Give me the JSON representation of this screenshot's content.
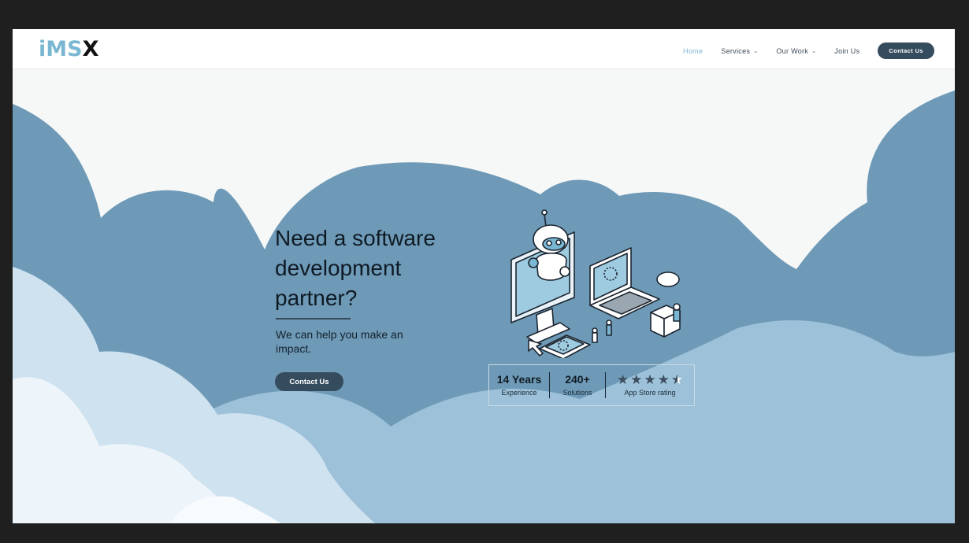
{
  "brand": {
    "logo_part1": "iMS",
    "logo_part2": "X"
  },
  "nav": {
    "items": [
      {
        "label": "Home",
        "active": true,
        "dropdown": false
      },
      {
        "label": "Services",
        "active": false,
        "dropdown": true
      },
      {
        "label": "Our Work",
        "active": false,
        "dropdown": true
      },
      {
        "label": "Join Us",
        "active": false,
        "dropdown": false
      }
    ],
    "cta_label": "Contact Us"
  },
  "hero": {
    "headline": "Need a software development partner?",
    "subtext": "We can help you make an impact.",
    "cta_label": "Contact Us"
  },
  "stats": [
    {
      "value": "14 Years",
      "label": "Experience"
    },
    {
      "value": "240+",
      "label": "Solutions"
    }
  ],
  "rating": {
    "label": "App Store rating",
    "stars": 4.5,
    "max": 5
  },
  "colors": {
    "accent": "#7ab7d2",
    "button": "#354b5e",
    "cloud_dark": "#6e9ab7",
    "cloud_mid": "#9cc1d8",
    "cloud_light": "#cfe2f0",
    "cloud_lightest": "#edf4fa",
    "page_bg": "#f6f7f7"
  },
  "icons": [
    "chevron-down-icon",
    "star-icon",
    "half-star-icon",
    "robot-computer-illustration"
  ]
}
